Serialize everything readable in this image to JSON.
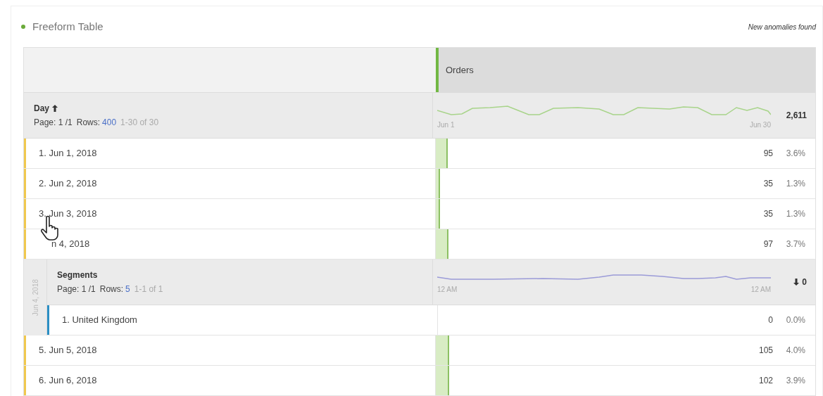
{
  "panel": {
    "title": "Freeform Table",
    "notice": "New anomalies found"
  },
  "table": {
    "column_header": "Orders",
    "dimension": {
      "name": "Day",
      "page": "Page: 1 /1",
      "rows_label": "Rows:",
      "rows": "400",
      "range": "1-30 of 30",
      "spark_start": "Jun 1",
      "spark_end": "Jun 30",
      "total": "2,611"
    },
    "rows": [
      {
        "kind": "row",
        "label": "1. Jun 1, 2018",
        "value": "95",
        "percent": "3.6%",
        "color": "#f0c84e"
      },
      {
        "kind": "row",
        "label": "2. Jun 2, 2018",
        "value": "35",
        "percent": "1.3%",
        "color": "#f0c84e"
      },
      {
        "kind": "row",
        "label": "3. Jun 3, 2018",
        "value": "35",
        "percent": "1.3%",
        "color": "#f0c84e"
      },
      {
        "kind": "row",
        "label": "n 4, 2018",
        "value": "97",
        "percent": "3.7%",
        "color": "#f0c84e",
        "cursor": true
      },
      {
        "kind": "breakdown",
        "side_label": "Jun 4, 2018",
        "name": "Segments",
        "page": "Page: 1 /1",
        "rows_label": "Rows:",
        "rows": "5",
        "range": "1-1 of 1",
        "spark_start": "12 AM",
        "spark_end": "12 AM",
        "total": "0",
        "children": [
          {
            "label": "1. United Kingdom",
            "value": "0",
            "percent": "0.0%",
            "color": "#2b8fc4"
          }
        ]
      },
      {
        "kind": "row",
        "label": "5. Jun 5, 2018",
        "value": "105",
        "percent": "4.0%",
        "color": "#f0c84e"
      },
      {
        "kind": "row",
        "label": "6. Jun 6, 2018",
        "value": "102",
        "percent": "3.9%",
        "color": "#f0c84e"
      }
    ]
  }
}
